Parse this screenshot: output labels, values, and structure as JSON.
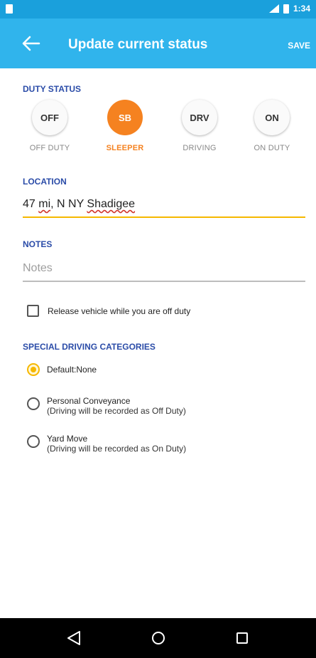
{
  "status_bar": {
    "time": "1:34",
    "accent": "#1aa0dc"
  },
  "app_bar": {
    "title": "Update current status",
    "save_label": "SAVE",
    "color": "#30b4ec"
  },
  "duty_status": {
    "header": "DUTY STATUS",
    "options": [
      {
        "code": "OFF",
        "label": "OFF DUTY",
        "active": false
      },
      {
        "code": "SB",
        "label": "SLEEPER",
        "active": true
      },
      {
        "code": "DRV",
        "label": "DRIVING",
        "active": false
      },
      {
        "code": "ON",
        "label": "ON DUTY",
        "active": false
      }
    ],
    "active_color": "#f58220"
  },
  "location": {
    "header": "LOCATION",
    "value_prefix": "47 ",
    "value_mi": "mi",
    "value_mid": ", N NY ",
    "value_place": "Shadigee"
  },
  "notes": {
    "header": "NOTES",
    "placeholder": "Notes"
  },
  "release_vehicle": {
    "label": "Release vehicle while you are off duty",
    "checked": false
  },
  "special_driving": {
    "header": "SPECIAL DRIVING CATEGORIES",
    "options": [
      {
        "label": "Default:None",
        "sub": "",
        "checked": true
      },
      {
        "label": "Personal Conveyance",
        "sub": "(Driving will be recorded as Off Duty)",
        "checked": false
      },
      {
        "label": "Yard Move",
        "sub": "(Driving will be recorded as On Duty)",
        "checked": false
      }
    ]
  },
  "nav": {
    "back": "back-triangle-icon",
    "home": "home-circle-icon",
    "recents": "recents-square-icon"
  }
}
